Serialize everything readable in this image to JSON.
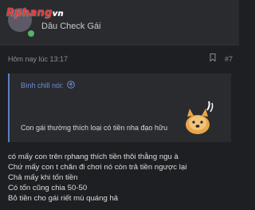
{
  "user": {
    "logo_main": "Rphang",
    "logo_suffix": "vn",
    "title": "Dâu Check Gái"
  },
  "post": {
    "time": "Hôm nay lúc 13:17",
    "number": "#7"
  },
  "quote": {
    "author": "Bình chill nói:",
    "text": "Con gái thường thích loại có tiền nha đạo hữu"
  },
  "message": {
    "lines": [
      "có mấy con trên rphang thích tiền thôi thằng ngu à",
      "Chứ mấy con t chăn đi chơi nó còn trả tiền ngược lại",
      "Chả mấy khi tốn tiền",
      "Có tốn cũng chia 50-50",
      "Bỏ tiền cho gái riết mù quáng hả"
    ]
  },
  "colors": {
    "background": "#1e1f22",
    "card": "#2a2b2f",
    "quote_accent": "#5a7fc4",
    "logo_red": "#e13a3a"
  }
}
